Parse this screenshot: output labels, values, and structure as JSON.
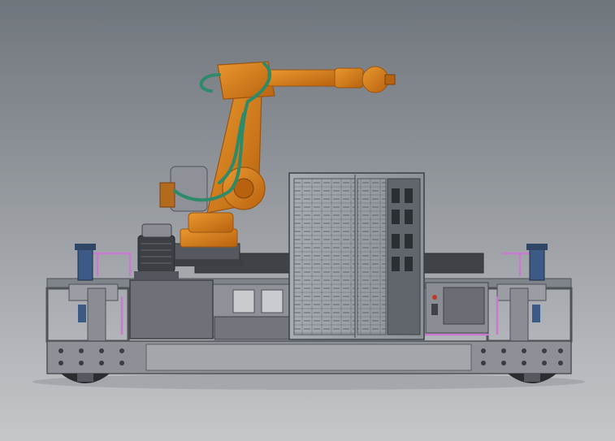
{
  "scene": {
    "subject": "cad-render-mobile-robot-platform",
    "colors": {
      "background_top": "#6f757c",
      "background_bottom": "#c5c7ca",
      "frame": "#8d9096",
      "frame_dark": "#4f5257",
      "robot_orange": "#d8801e",
      "robot_orange_dark": "#9b5410",
      "robot_cable": "#2f8a6a",
      "cabinet_glass": "#9aa0a8",
      "cabinet_panel": "#555a60",
      "pink_rail": "#c77ad0",
      "motor_dark": "#3c3f44",
      "wheel_dark": "#2a2c30"
    }
  }
}
